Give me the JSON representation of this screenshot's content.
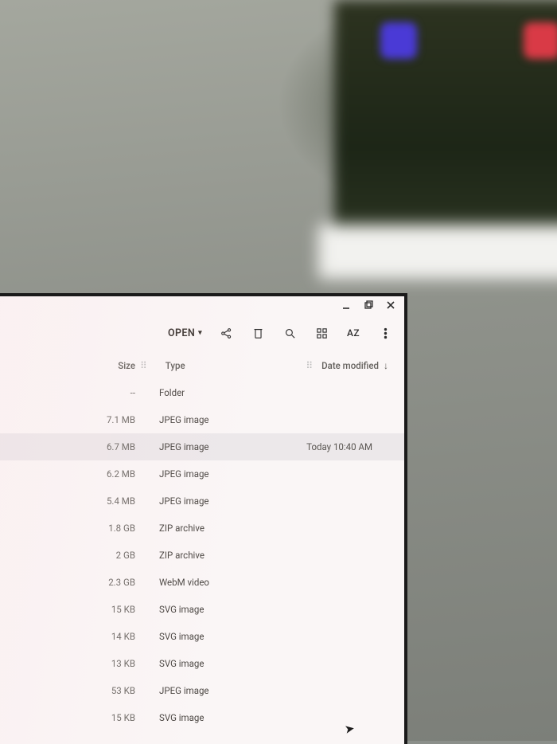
{
  "titlebar": {
    "minimize": "minimize",
    "maximize": "restore",
    "close": "close"
  },
  "toolbar": {
    "open_label": "OPEN",
    "sort_label": "AZ"
  },
  "columns": {
    "size": "Size",
    "type": "Type",
    "date_modified": "Date modified"
  },
  "rows": [
    {
      "size": "--",
      "type": "Folder",
      "date": "",
      "selected": false
    },
    {
      "size": "7.1 MB",
      "type": "JPEG image",
      "date": "",
      "selected": false
    },
    {
      "size": "6.7 MB",
      "type": "JPEG image",
      "date": "Today 10:40 AM",
      "selected": true
    },
    {
      "size": "6.2 MB",
      "type": "JPEG image",
      "date": "",
      "selected": false
    },
    {
      "size": "5.4 MB",
      "type": "JPEG image",
      "date": "",
      "selected": false
    },
    {
      "size": "1.8 GB",
      "type": "ZIP archive",
      "date": "",
      "selected": false
    },
    {
      "size": "2 GB",
      "type": "ZIP archive",
      "date": "",
      "selected": false
    },
    {
      "size": "2.3 GB",
      "type": "WebM video",
      "date": "",
      "selected": false
    },
    {
      "size": "15 KB",
      "type": "SVG image",
      "date": "",
      "selected": false
    },
    {
      "size": "14 KB",
      "type": "SVG image",
      "date": "",
      "selected": false
    },
    {
      "size": "13 KB",
      "type": "SVG image",
      "date": "",
      "selected": false
    },
    {
      "size": "53 KB",
      "type": "JPEG image",
      "date": "",
      "selected": false
    },
    {
      "size": "15 KB",
      "type": "SVG image",
      "date": "",
      "selected": false
    }
  ]
}
